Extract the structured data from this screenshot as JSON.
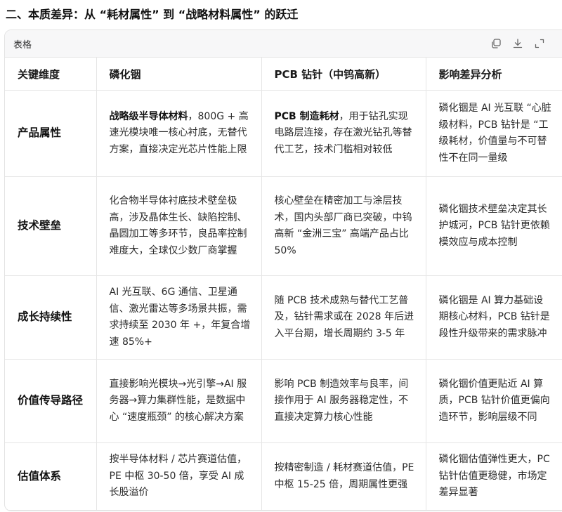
{
  "heading": "二、本质差异：从 “耗材属性” 到 “战略材料属性” 的跃迁",
  "card": {
    "title": "表格",
    "tools": [
      "copy-icon",
      "download-icon",
      "expand-icon"
    ]
  },
  "table": {
    "headers": [
      "关键维度",
      "磷化铟",
      "PCB 钻针（中钨高新）",
      "影响差异分析"
    ],
    "rows": [
      {
        "dim": "产品属性",
        "inp_bold": "战略级半导体材料",
        "inp": "，800G + 高速光模块唯一核心衬底，无替代方案，直接决定光芯片性能上限",
        "pcb_bold": "PCB 制造耗材",
        "pcb": "，用于钻孔实现电路层连接，存在激光钻孔等替代工艺，技术门槛相对较低",
        "diff": [
          "磷化铟是 AI 光互联 “心脏",
          "级材料，PCB 钻针是 “工",
          "级耗材，价值量与不可替",
          "性不在同一量级"
        ]
      },
      {
        "dim": "技术壁垒",
        "inp": "化合物半导体衬底技术壁垒极高，涉及晶体生长、缺陷控制、晶圆加工等多环节，良品率控制难度大，全球仅少数厂商掌握",
        "pcb": "核心壁垒在精密加工与涂层技术，国内头部厂商已突破，中钨高新 “金洲三宝” 高端产品占比 50%",
        "diff": [
          "磷化铟技术壁垒决定其长",
          "护城河，PCB 钻针更依赖",
          "模效应与成本控制"
        ]
      },
      {
        "dim": "成长持续性",
        "inp": "AI 光互联、6G 通信、卫星通信、激光雷达等多场景共振，需求持续至 2030 年 +，年复合增速 85%+",
        "pcb": "随 PCB 技术成熟与替代工艺普及，钻针需求或在 2028 年后进入平台期，增长周期约 3-5 年",
        "diff": [
          "磷化铟是 AI 算力基础设",
          "期核心材料，PCB 钻针是",
          "段性升级带来的需求脉冲"
        ]
      },
      {
        "dim": "价值传导路径",
        "inp": "直接影响光模块→光引擎→AI 服务器→算力集群性能，是数据中心 “速度瓶颈” 的核心解决方案",
        "pcb": "影响 PCB 制造效率与良率，间接作用于 AI 服务器稳定性，不直接决定算力核心性能",
        "diff": [
          "磷化铟价值更贴近 AI 算",
          "质，PCB 钻针价值更偏向",
          "造环节，影响层级不同"
        ]
      },
      {
        "dim": "估值体系",
        "inp": "按半导体材料 / 芯片赛道估值，PE 中枢 30-50 倍，享受 AI 成长股溢价",
        "pcb": "按精密制造 / 耗材赛道估值，PE 中枢 15-25 倍，周期属性更强",
        "diff": [
          "磷化铟估值弹性更大，PC",
          "钻针估值更稳健，市场定",
          "差异显著"
        ]
      }
    ]
  }
}
